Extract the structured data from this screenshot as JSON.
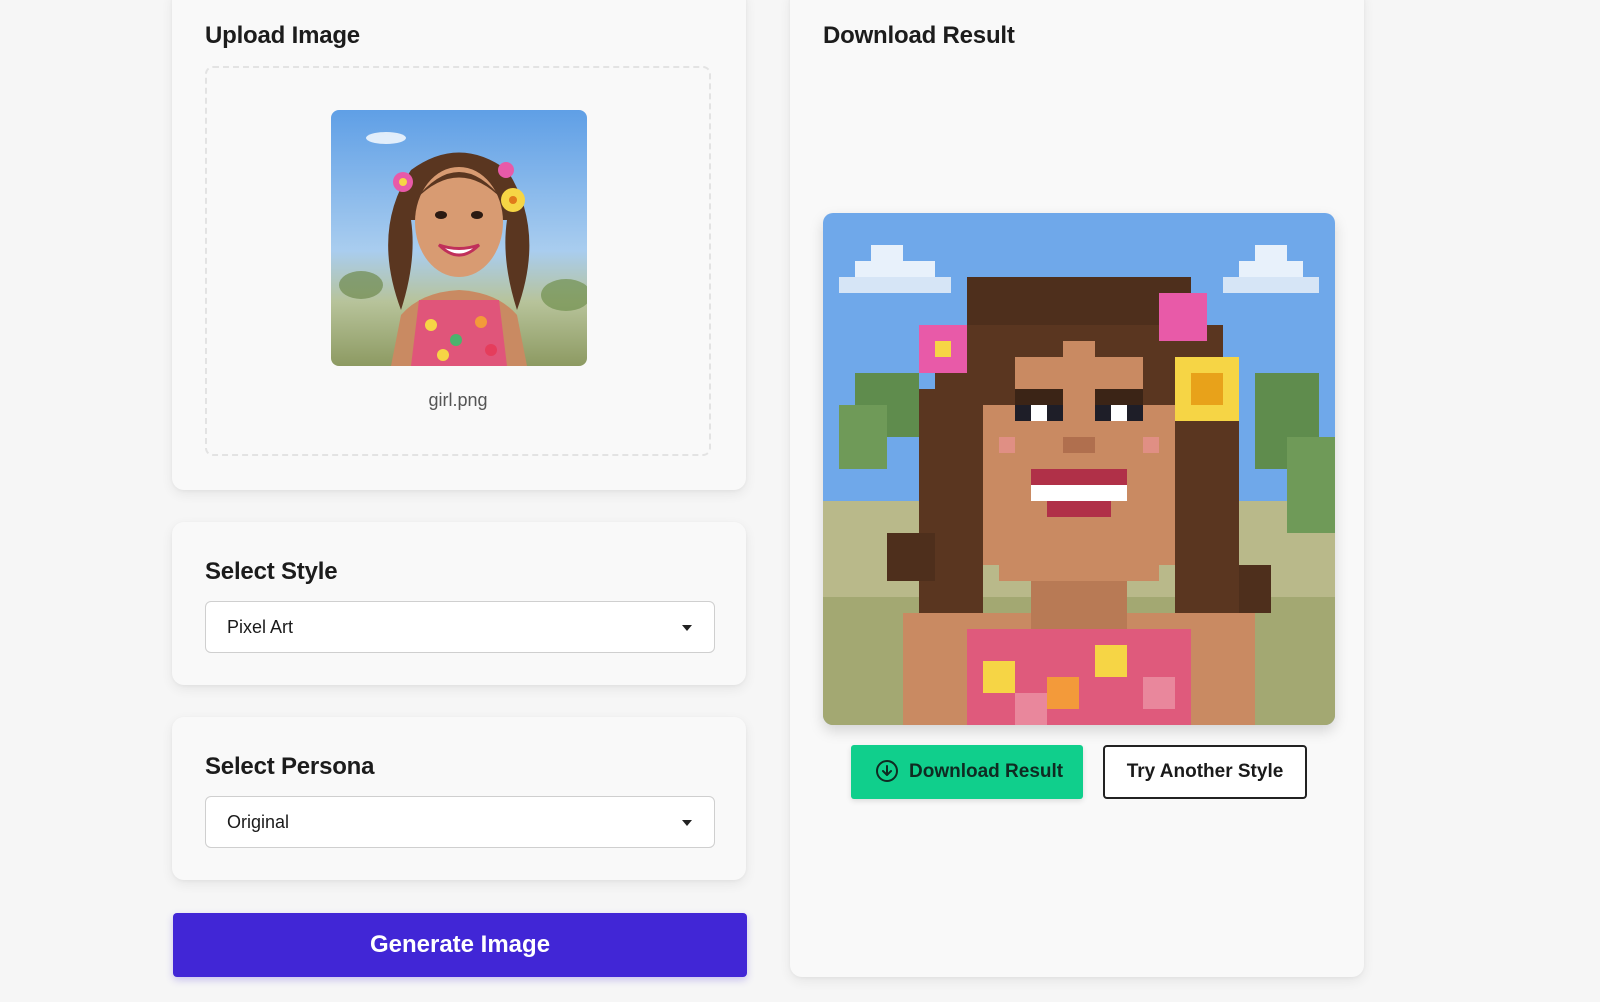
{
  "upload": {
    "title": "Upload Image",
    "file_name": "girl.png"
  },
  "style": {
    "title": "Select Style",
    "selected": "Pixel Art"
  },
  "persona": {
    "title": "Select Persona",
    "selected": "Original"
  },
  "generate": {
    "label": "Generate Image",
    "color": "#4126d6"
  },
  "result": {
    "title": "Download Result",
    "download_label": "Download Result",
    "try_label": "Try Another Style",
    "download_color": "#10cf8c"
  },
  "icons": {
    "download": "download-circle-icon",
    "dropdown": "chevron-down-icon"
  }
}
